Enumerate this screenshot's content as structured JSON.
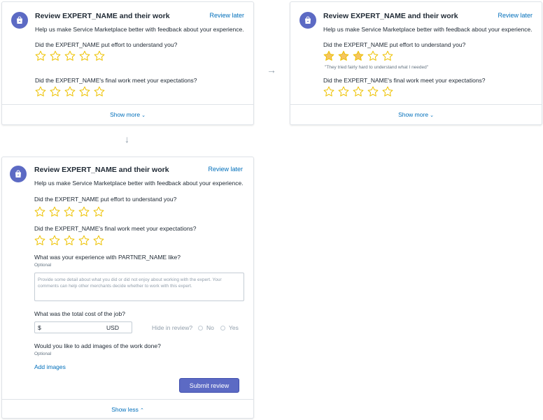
{
  "colors": {
    "accent": "#5c6ac4",
    "link": "#006fbb",
    "star": "#f4c464",
    "star_outline": "#eec200"
  },
  "card1": {
    "title": "Review EXPERT_NAME and their work",
    "review_later": "Review later",
    "subtitle": "Help us make Service Marketplace better with feedback about your experience.",
    "q1": "Did the EXPERT_NAME put effort to understand you?",
    "q2": "Did the EXPERT_NAME's final work meet your expectations?",
    "q1_rating": 0,
    "q2_rating": 0,
    "footer": "Show more",
    "footer_icon": "chevron-down-icon"
  },
  "card2": {
    "title": "Review EXPERT_NAME and their work",
    "review_later": "Review later",
    "subtitle": "Help us make Service Marketplace better with feedback about your experience.",
    "q1": "Did the EXPERT_NAME put effort to understand you?",
    "q1_rating": 3,
    "q1_caption": "\"They tried fairly hard to understand what I needed\"",
    "q2": "Did the EXPERT_NAME's final work meet your expectations?",
    "q2_rating": 0,
    "footer": "Show more",
    "footer_icon": "chevron-down-icon"
  },
  "card3": {
    "title": "Review EXPERT_NAME and their work",
    "review_later": "Review later",
    "subtitle": "Help us make Service Marketplace better with feedback about your experience.",
    "q1": "Did the EXPERT_NAME put effort to understand you?",
    "q2": "Did the EXPERT_NAME's final work meet your expectations?",
    "q1_rating": 0,
    "q2_rating": 0,
    "experience_label": "What was your experience with PARTNER_NAME like?",
    "optional": "Optional",
    "experience_placeholder": "Provide some detail about what you did or did not enjoy about working with the expert. Your comments can help other merchants decide whether to work with this expert.",
    "cost_label": "What was the total cost of the job?",
    "cost_prefix": "$",
    "cost_unit": "USD",
    "hide_label": "Hide in review?",
    "hide_no": "No",
    "hide_yes": "Yes",
    "images_label": "Would you like to add images of the work done?",
    "images_optional": "Optional",
    "add_images": "Add images",
    "submit": "Submit review",
    "footer": "Show less",
    "footer_icon": "chevron-up-icon"
  },
  "arrows": {
    "right": "→",
    "down": "↓"
  }
}
